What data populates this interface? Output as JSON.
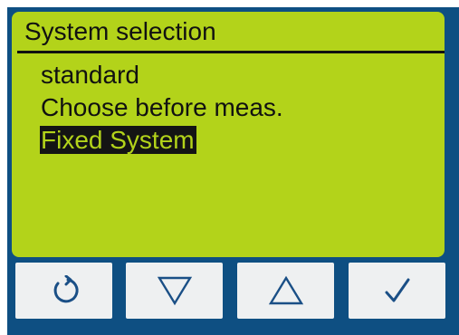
{
  "screen": {
    "title": "System selection",
    "items": [
      {
        "label": "standard",
        "selected": false
      },
      {
        "label": "Choose before meas.",
        "selected": false
      },
      {
        "label": "Fixed System",
        "selected": true
      }
    ]
  },
  "softkeys": [
    {
      "icon": "refresh-icon"
    },
    {
      "icon": "triangle-down-icon"
    },
    {
      "icon": "triangle-up-icon"
    },
    {
      "icon": "checkmark-icon"
    }
  ],
  "colors": {
    "bezel": "#0e4f82",
    "lcd_background": "#b3d31a",
    "text": "#111111",
    "highlight": "#141414",
    "button_face": "#eef0f1",
    "icon": "#1a4f86"
  }
}
